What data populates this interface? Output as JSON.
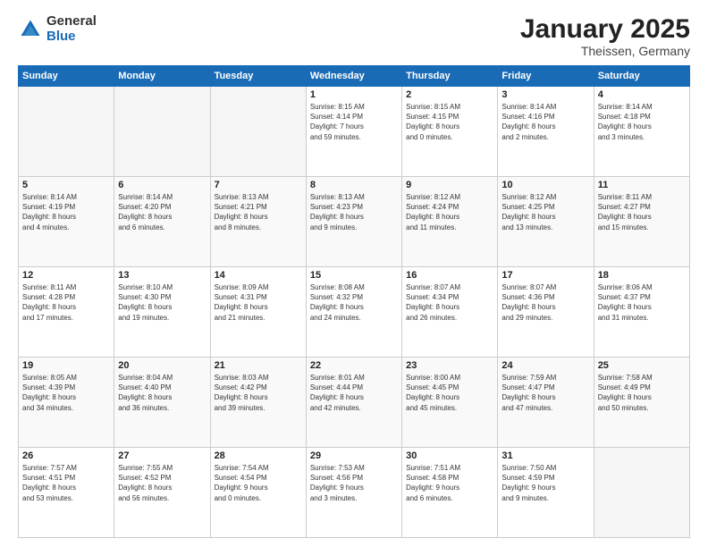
{
  "logo": {
    "general": "General",
    "blue": "Blue"
  },
  "title": {
    "month": "January 2025",
    "location": "Theissen, Germany"
  },
  "days_of_week": [
    "Sunday",
    "Monday",
    "Tuesday",
    "Wednesday",
    "Thursday",
    "Friday",
    "Saturday"
  ],
  "weeks": [
    [
      {
        "day": "",
        "info": ""
      },
      {
        "day": "",
        "info": ""
      },
      {
        "day": "",
        "info": ""
      },
      {
        "day": "1",
        "info": "Sunrise: 8:15 AM\nSunset: 4:14 PM\nDaylight: 7 hours\nand 59 minutes."
      },
      {
        "day": "2",
        "info": "Sunrise: 8:15 AM\nSunset: 4:15 PM\nDaylight: 8 hours\nand 0 minutes."
      },
      {
        "day": "3",
        "info": "Sunrise: 8:14 AM\nSunset: 4:16 PM\nDaylight: 8 hours\nand 2 minutes."
      },
      {
        "day": "4",
        "info": "Sunrise: 8:14 AM\nSunset: 4:18 PM\nDaylight: 8 hours\nand 3 minutes."
      }
    ],
    [
      {
        "day": "5",
        "info": "Sunrise: 8:14 AM\nSunset: 4:19 PM\nDaylight: 8 hours\nand 4 minutes."
      },
      {
        "day": "6",
        "info": "Sunrise: 8:14 AM\nSunset: 4:20 PM\nDaylight: 8 hours\nand 6 minutes."
      },
      {
        "day": "7",
        "info": "Sunrise: 8:13 AM\nSunset: 4:21 PM\nDaylight: 8 hours\nand 8 minutes."
      },
      {
        "day": "8",
        "info": "Sunrise: 8:13 AM\nSunset: 4:23 PM\nDaylight: 8 hours\nand 9 minutes."
      },
      {
        "day": "9",
        "info": "Sunrise: 8:12 AM\nSunset: 4:24 PM\nDaylight: 8 hours\nand 11 minutes."
      },
      {
        "day": "10",
        "info": "Sunrise: 8:12 AM\nSunset: 4:25 PM\nDaylight: 8 hours\nand 13 minutes."
      },
      {
        "day": "11",
        "info": "Sunrise: 8:11 AM\nSunset: 4:27 PM\nDaylight: 8 hours\nand 15 minutes."
      }
    ],
    [
      {
        "day": "12",
        "info": "Sunrise: 8:11 AM\nSunset: 4:28 PM\nDaylight: 8 hours\nand 17 minutes."
      },
      {
        "day": "13",
        "info": "Sunrise: 8:10 AM\nSunset: 4:30 PM\nDaylight: 8 hours\nand 19 minutes."
      },
      {
        "day": "14",
        "info": "Sunrise: 8:09 AM\nSunset: 4:31 PM\nDaylight: 8 hours\nand 21 minutes."
      },
      {
        "day": "15",
        "info": "Sunrise: 8:08 AM\nSunset: 4:32 PM\nDaylight: 8 hours\nand 24 minutes."
      },
      {
        "day": "16",
        "info": "Sunrise: 8:07 AM\nSunset: 4:34 PM\nDaylight: 8 hours\nand 26 minutes."
      },
      {
        "day": "17",
        "info": "Sunrise: 8:07 AM\nSunset: 4:36 PM\nDaylight: 8 hours\nand 29 minutes."
      },
      {
        "day": "18",
        "info": "Sunrise: 8:06 AM\nSunset: 4:37 PM\nDaylight: 8 hours\nand 31 minutes."
      }
    ],
    [
      {
        "day": "19",
        "info": "Sunrise: 8:05 AM\nSunset: 4:39 PM\nDaylight: 8 hours\nand 34 minutes."
      },
      {
        "day": "20",
        "info": "Sunrise: 8:04 AM\nSunset: 4:40 PM\nDaylight: 8 hours\nand 36 minutes."
      },
      {
        "day": "21",
        "info": "Sunrise: 8:03 AM\nSunset: 4:42 PM\nDaylight: 8 hours\nand 39 minutes."
      },
      {
        "day": "22",
        "info": "Sunrise: 8:01 AM\nSunset: 4:44 PM\nDaylight: 8 hours\nand 42 minutes."
      },
      {
        "day": "23",
        "info": "Sunrise: 8:00 AM\nSunset: 4:45 PM\nDaylight: 8 hours\nand 45 minutes."
      },
      {
        "day": "24",
        "info": "Sunrise: 7:59 AM\nSunset: 4:47 PM\nDaylight: 8 hours\nand 47 minutes."
      },
      {
        "day": "25",
        "info": "Sunrise: 7:58 AM\nSunset: 4:49 PM\nDaylight: 8 hours\nand 50 minutes."
      }
    ],
    [
      {
        "day": "26",
        "info": "Sunrise: 7:57 AM\nSunset: 4:51 PM\nDaylight: 8 hours\nand 53 minutes."
      },
      {
        "day": "27",
        "info": "Sunrise: 7:55 AM\nSunset: 4:52 PM\nDaylight: 8 hours\nand 56 minutes."
      },
      {
        "day": "28",
        "info": "Sunrise: 7:54 AM\nSunset: 4:54 PM\nDaylight: 9 hours\nand 0 minutes."
      },
      {
        "day": "29",
        "info": "Sunrise: 7:53 AM\nSunset: 4:56 PM\nDaylight: 9 hours\nand 3 minutes."
      },
      {
        "day": "30",
        "info": "Sunrise: 7:51 AM\nSunset: 4:58 PM\nDaylight: 9 hours\nand 6 minutes."
      },
      {
        "day": "31",
        "info": "Sunrise: 7:50 AM\nSunset: 4:59 PM\nDaylight: 9 hours\nand 9 minutes."
      },
      {
        "day": "",
        "info": ""
      }
    ]
  ]
}
